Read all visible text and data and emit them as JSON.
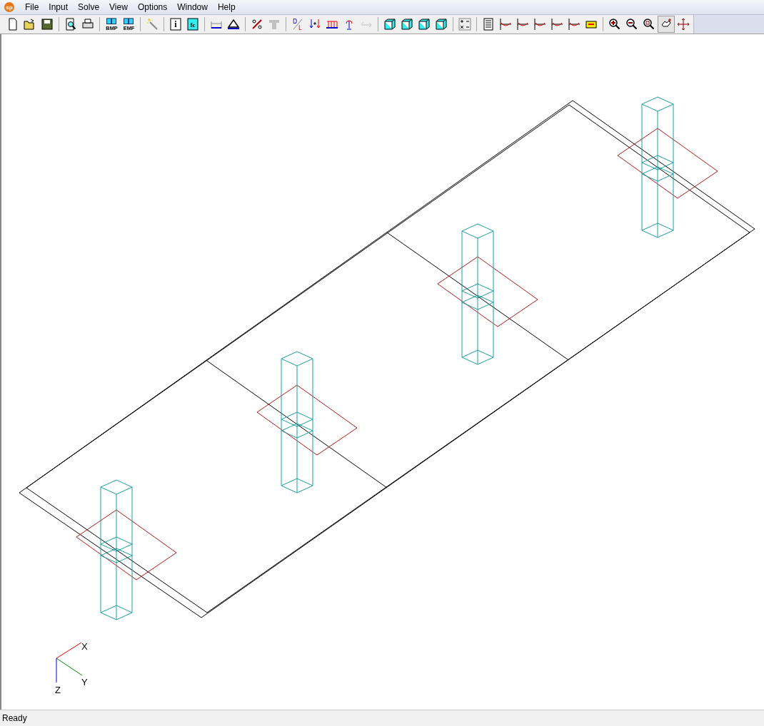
{
  "app_icon_label": "sp",
  "menu": [
    {
      "label": "File"
    },
    {
      "label": "Input"
    },
    {
      "label": "Solve"
    },
    {
      "label": "View"
    },
    {
      "label": "Options"
    },
    {
      "label": "Window"
    },
    {
      "label": "Help"
    }
  ],
  "toolbar": [
    [
      {
        "kind": "new",
        "disabled": false,
        "selected": false
      },
      {
        "kind": "open",
        "disabled": false,
        "selected": false
      },
      {
        "kind": "save",
        "disabled": false,
        "selected": false
      }
    ],
    [
      {
        "kind": "preview",
        "disabled": false,
        "selected": false
      },
      {
        "kind": "print",
        "disabled": false,
        "selected": false
      }
    ],
    [
      {
        "kind": "export",
        "label": "BMP",
        "disabled": false,
        "selected": false
      },
      {
        "kind": "export",
        "label": "EMF",
        "disabled": false,
        "selected": false
      }
    ],
    [
      {
        "kind": "wand",
        "disabled": false,
        "selected": false
      }
    ],
    [
      {
        "kind": "letter",
        "label": "i",
        "disabled": false,
        "selected": false
      },
      {
        "kind": "letter",
        "label": "fc",
        "disabled": false,
        "selected": false
      }
    ],
    [
      {
        "kind": "dimension",
        "disabled": false,
        "selected": false
      },
      {
        "kind": "support",
        "disabled": false,
        "selected": false
      }
    ],
    [
      {
        "kind": "hatch",
        "disabled": false,
        "selected": false
      },
      {
        "kind": "tbeam",
        "disabled": true,
        "selected": false
      }
    ],
    [
      {
        "kind": "ratio",
        "label": "D",
        "label2": "L",
        "disabled": false,
        "selected": false
      },
      {
        "kind": "loads",
        "disabled": false,
        "selected": false
      },
      {
        "kind": "distributed",
        "disabled": false,
        "selected": false
      },
      {
        "kind": "moment",
        "disabled": false,
        "selected": false
      },
      {
        "kind": "swap",
        "disabled": true,
        "selected": false
      }
    ],
    [
      {
        "kind": "cube",
        "disabled": false,
        "selected": false
      },
      {
        "kind": "cube",
        "disabled": false,
        "selected": false
      },
      {
        "kind": "cube",
        "disabled": false,
        "selected": false
      },
      {
        "kind": "cube",
        "disabled": false,
        "selected": false
      }
    ],
    [
      {
        "kind": "calc",
        "disabled": false,
        "selected": false
      }
    ],
    [
      {
        "kind": "report",
        "disabled": false,
        "selected": false
      },
      {
        "kind": "chart",
        "disabled": false,
        "selected": false
      },
      {
        "kind": "chart",
        "disabled": false,
        "selected": false
      },
      {
        "kind": "chart",
        "disabled": false,
        "selected": false
      },
      {
        "kind": "chart",
        "disabled": false,
        "selected": false
      },
      {
        "kind": "chart",
        "disabled": false,
        "selected": false
      },
      {
        "kind": "section",
        "disabled": false,
        "selected": false
      }
    ],
    [
      {
        "kind": "zoom-in",
        "disabled": false,
        "selected": false
      },
      {
        "kind": "zoom-out",
        "disabled": false,
        "selected": false
      },
      {
        "kind": "zoom-window",
        "disabled": false,
        "selected": false
      },
      {
        "kind": "hand",
        "disabled": false,
        "selected": true
      },
      {
        "kind": "move",
        "disabled": false,
        "selected": false
      }
    ]
  ],
  "axes": {
    "x": "X",
    "y": "Y",
    "z": "Z"
  },
  "status_bar": "Ready"
}
